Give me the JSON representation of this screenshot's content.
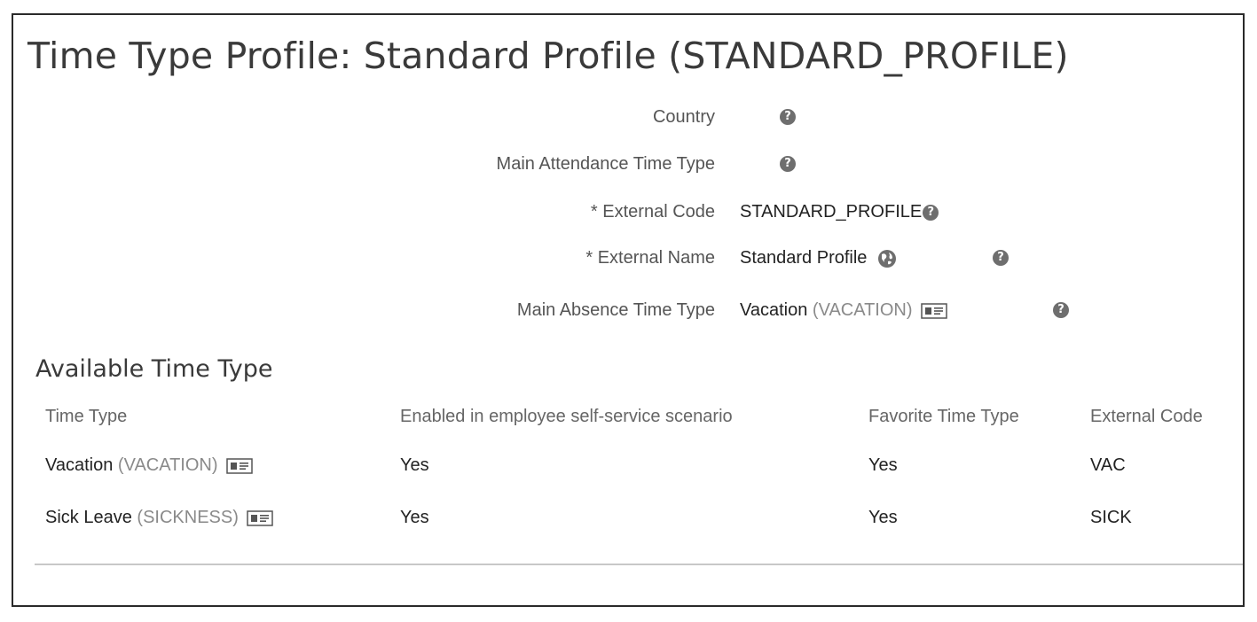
{
  "page": {
    "title": "Time Type Profile: Standard Profile (STANDARD_PROFILE)"
  },
  "fields": {
    "country": {
      "label": "Country"
    },
    "main_attendance": {
      "label": "Main Attendance Time Type"
    },
    "external_code": {
      "label": "* External Code",
      "value": "STANDARD_PROFILE"
    },
    "external_name": {
      "label": "* External Name",
      "value": "Standard Profile"
    },
    "main_absence": {
      "label": "Main Absence Time Type",
      "value": "Vacation",
      "code": "(VACATION)"
    }
  },
  "section": {
    "title": "Available Time Type"
  },
  "table": {
    "headers": {
      "time_type": "Time Type",
      "enabled": "Enabled in employee self-service scenario",
      "favorite": "Favorite Time Type",
      "external_code": "External Code"
    },
    "rows": [
      {
        "name": "Vacation",
        "code": "(VACATION)",
        "enabled": "Yes",
        "favorite": "Yes",
        "external_code": "VAC"
      },
      {
        "name": "Sick Leave",
        "code": "(SICKNESS)",
        "enabled": "Yes",
        "favorite": "Yes",
        "external_code": "SICK"
      }
    ]
  },
  "icons": {
    "help": "question-mark-help-icon",
    "translate": "globe-icon",
    "details": "details-card-icon"
  },
  "colors": {
    "border": "#2a2a2a",
    "help_icon": "#6e6e6e",
    "code_text": "#8a8a8a",
    "divider": "#c8c8c8"
  }
}
